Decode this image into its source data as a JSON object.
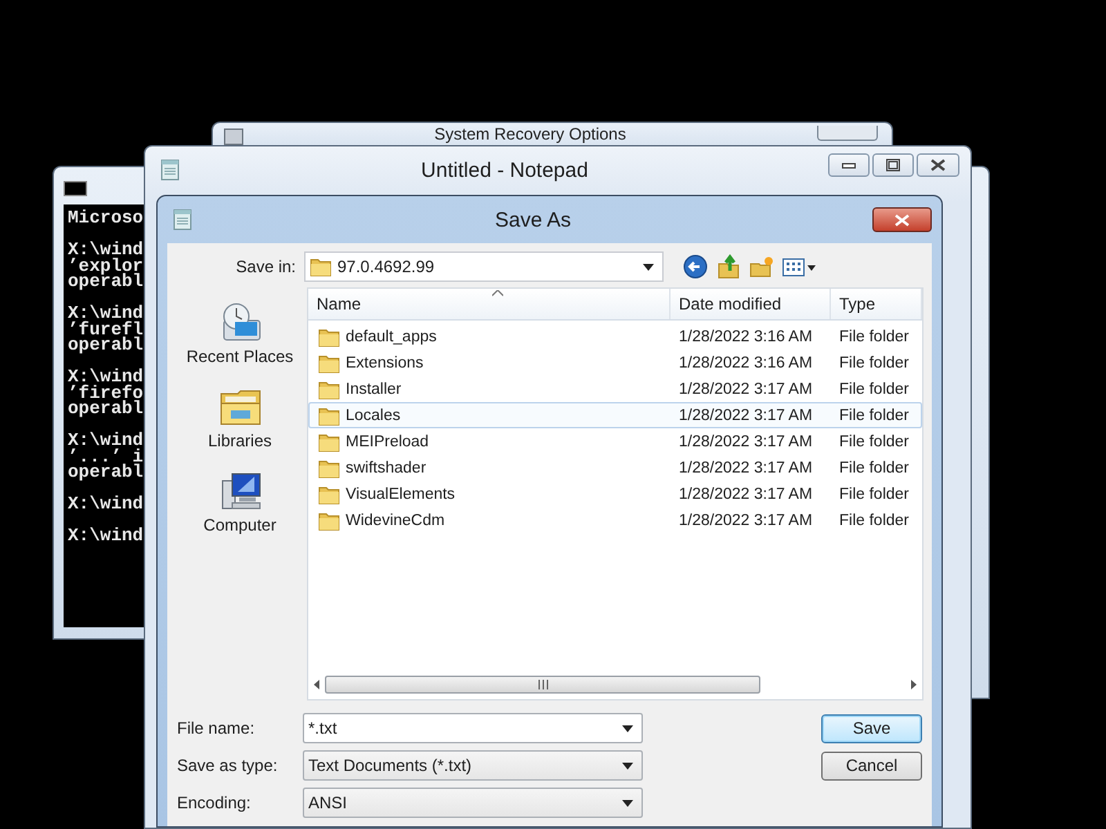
{
  "background_window": {
    "title": "System Recovery Options"
  },
  "console": {
    "blocks": [
      [
        "Microso"
      ],
      [
        "X:\\wind",
        "’explor",
        "operabl"
      ],
      [
        "X:\\wind",
        "’furefl",
        "operabl"
      ],
      [
        "X:\\wind",
        "’firefo",
        "operabl"
      ],
      [
        "X:\\wind",
        "’...’ i",
        "operabl"
      ],
      [
        "X:\\wind"
      ],
      [
        "X:\\wind"
      ]
    ]
  },
  "notepad": {
    "title": "Untitled - Notepad"
  },
  "save_dialog": {
    "title": "Save As",
    "save_in": {
      "label": "Save in:",
      "value": "97.0.4692.99"
    },
    "places": [
      {
        "label": "Recent Places",
        "kind": "recent"
      },
      {
        "label": "Libraries",
        "kind": "libraries"
      },
      {
        "label": "Computer",
        "kind": "computer"
      }
    ],
    "file_list": {
      "columns": [
        "Name",
        "Date modified",
        "Type"
      ],
      "rows": [
        {
          "name": "default_apps",
          "date": "1/28/2022 3:16 AM",
          "type": "File folder",
          "selected": false
        },
        {
          "name": "Extensions",
          "date": "1/28/2022 3:16 AM",
          "type": "File folder",
          "selected": false
        },
        {
          "name": "Installer",
          "date": "1/28/2022 3:17 AM",
          "type": "File folder",
          "selected": false
        },
        {
          "name": "Locales",
          "date": "1/28/2022 3:17 AM",
          "type": "File folder",
          "selected": true
        },
        {
          "name": "MEIPreload",
          "date": "1/28/2022 3:17 AM",
          "type": "File folder",
          "selected": false
        },
        {
          "name": "swiftshader",
          "date": "1/28/2022 3:17 AM",
          "type": "File folder",
          "selected": false
        },
        {
          "name": "VisualElements",
          "date": "1/28/2022 3:17 AM",
          "type": "File folder",
          "selected": false
        },
        {
          "name": "WidevineCdm",
          "date": "1/28/2022 3:17 AM",
          "type": "File folder",
          "selected": false
        }
      ]
    },
    "fields": [
      {
        "label": "File name:",
        "value": "*.txt",
        "kind": "editable"
      },
      {
        "label": "Save as type:",
        "value": "Text Documents (*.txt)",
        "kind": "dropdown"
      },
      {
        "label": "Encoding:",
        "value": "ANSI",
        "kind": "dropdown"
      }
    ],
    "buttons": [
      {
        "label": "Save",
        "default": true
      },
      {
        "label": "Cancel",
        "default": false
      }
    ]
  }
}
